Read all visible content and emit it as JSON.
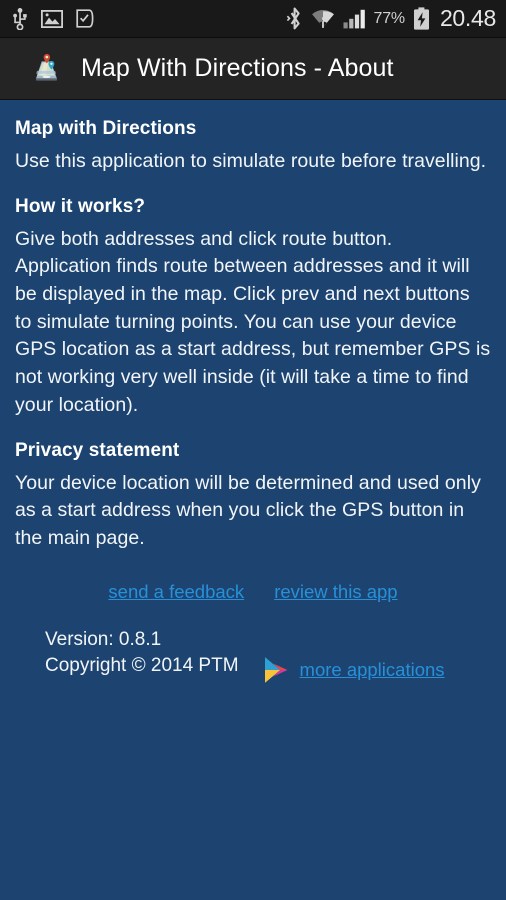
{
  "status_bar": {
    "icons_left": [
      "usb-icon",
      "gallery-image-icon",
      "note-check-icon"
    ],
    "icons_right": [
      "bluetooth-icon",
      "wifi-icon",
      "cellular-signal-icon"
    ],
    "battery_percent": "77%",
    "battery_state": "charging",
    "clock": "20.48"
  },
  "action_bar": {
    "app_icon": "map-with-pins-icon",
    "title": "Map With Directions - About"
  },
  "content": {
    "section1_heading": "Map with Directions",
    "section1_body": "Use this application to simulate route before travelling.",
    "section2_heading": "How it works?",
    "section2_body": "Give both addresses and click route button. Application finds route between addresses and it will be displayed in the map. Click prev and next buttons to simulate turning points. You can use your device GPS location as a start address, but remember GPS is not working very well inside (it will take a time to find your location).",
    "section3_heading": "Privacy statement",
    "section3_body": "Your device location will be determined and used only as a start address when you click the GPS button in the main page."
  },
  "links": {
    "feedback": "send a feedback",
    "review": "review this app",
    "more_applications": "more applications"
  },
  "footer": {
    "version": "Version: 0.8.1",
    "copyright": "Copyright © 2014 PTM",
    "play_icon": "google-play-icon"
  },
  "colors": {
    "background": "#1d4471",
    "action_bar": "#242424",
    "status_bar": "#191919",
    "link": "#2790d8",
    "text": "#f2f5f8"
  }
}
